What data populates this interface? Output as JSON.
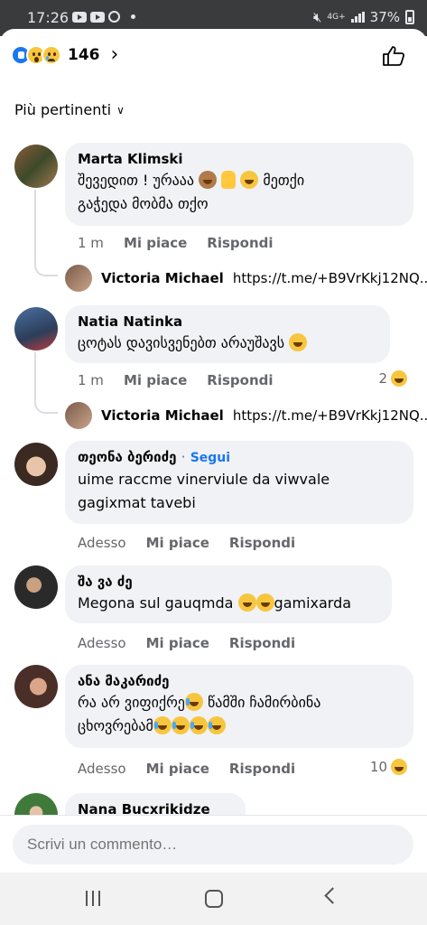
{
  "status_bar": {
    "time": "17:26",
    "network": "4G+",
    "battery": "37%"
  },
  "header": {
    "reaction_count": "146",
    "reactions": [
      "like",
      "wow",
      "sad"
    ]
  },
  "sort_label": "Più pertinenti",
  "actions": {
    "like": "Mi piace",
    "reply": "Rispondi",
    "follow": "Segui"
  },
  "comments": [
    {
      "author": "Marta Klimski",
      "text_line1": "შევედით !  ურააა",
      "text_line1_tail": "მეთქი",
      "text_line2": "გაჭედა მობმა თქო",
      "time": "1 m",
      "reply": {
        "author": "Victoria Michael",
        "text": "https://t.me/+B9VrKkj12NQ..."
      }
    },
    {
      "author": "Natia Natinka",
      "text_line1": "ცოტას დავისვენებთ არაუშავს",
      "time": "1 m",
      "reaction_count": "2",
      "reply": {
        "author": "Victoria Michael",
        "text": "https://t.me/+B9VrKkj12NQ..."
      }
    },
    {
      "author": "თეონა ბერიძე",
      "text_line1": "uime raccme vinerviule da viwvale",
      "text_line2": "gagixmat tavebi",
      "time": "Adesso"
    },
    {
      "author": "შა ვა ძე",
      "text_line1": "Megona sul gauqmda",
      "text_line1_tail": "gamixarda",
      "time": "Adesso"
    },
    {
      "author": "ანა მაკარიძე",
      "text_line1": "რა არ ვიფიქრე",
      "text_line1_tail": "წამში ჩამირბინა",
      "text_line2": "ცხოვრებამ",
      "time": "Adesso",
      "reaction_count": "10"
    },
    {
      "author": "Nana Bucxrikidze"
    }
  ],
  "composer": {
    "placeholder": "Scrivi un commento…"
  },
  "colors": {
    "accent": "#1877f2",
    "bubble": "#f0f2f5",
    "status_bar": "#3a3b3c"
  }
}
